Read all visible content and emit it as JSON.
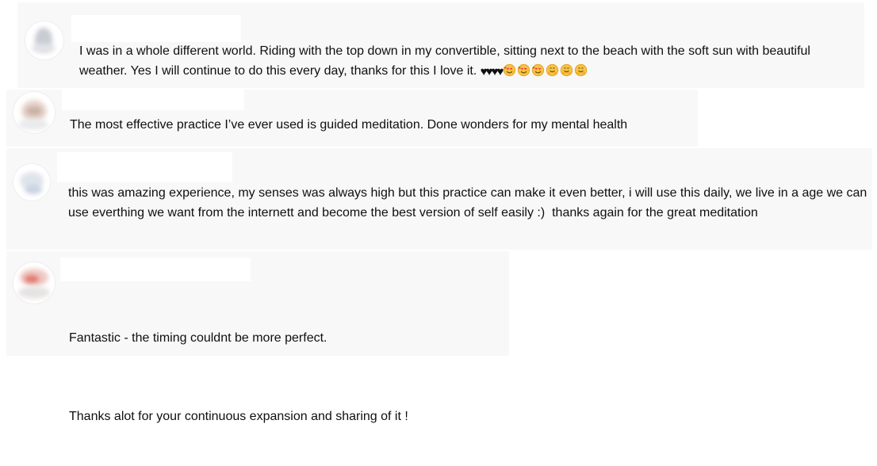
{
  "comments": [
    {
      "text": "I was in a whole different world. Riding with the top down in my convertible, sitting next to the beach with the soft sun with beautiful weather. Yes I will continue to do this every day, thanks for this I love it.",
      "emojis": [
        "black-heart",
        "black-heart",
        "black-heart",
        "black-heart",
        "smiling-face-with-hearts",
        "smiling-face-with-hearts",
        "smiling-face-with-hearts",
        "hugging-face",
        "hugging-face",
        "hugging-face"
      ]
    },
    {
      "text": "The most effective practice I’ve ever used is guided meditation. Done wonders for my mental health"
    },
    {
      "text": "this was amazing experience, my senses was always high but this practice can make it even better, i will use this daily, we live in a age we can use everthing we want from the internett and become the best version of self easily :)  thanks again for the great meditation"
    },
    {
      "paragraphs": [
        "Fantastic - the timing couldnt be more perfect.",
        "Thanks alot for your continuous expansion and sharing of it !"
      ]
    }
  ],
  "colors": {
    "card_background": "#f8f8f8",
    "text": "#0f0f0f",
    "name_redaction": "#ffffff"
  }
}
